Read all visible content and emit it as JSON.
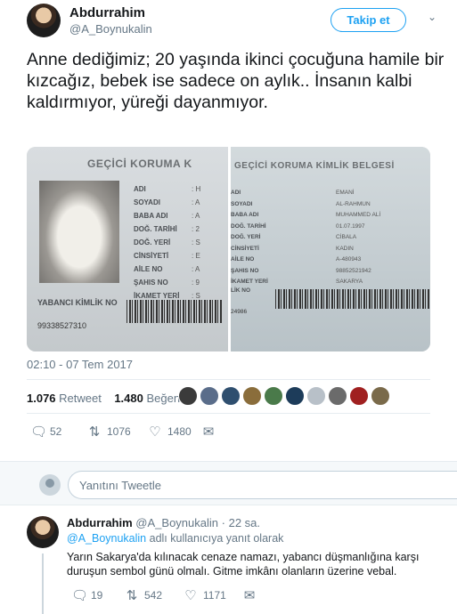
{
  "tweet": {
    "author_name": "Abdurrahim",
    "author_handle": "@A_Boynukalin",
    "follow_label": "Takip et",
    "text": "Anne dediğimiz; 20 yaşında ikinci çocuğuna hamile bir kızcağız, bebek ise sadece on aylık.. İnsanın kalbi kaldırmıyor, yüreği dayanmıyor.",
    "timestamp": "02:10 - 07 Tem 2017",
    "retweets_count": "1.076",
    "retweets_label": "Retweet",
    "likes_count": "1.480",
    "likes_label": "Beğeni",
    "reply_count": "52",
    "retweet_count_action": "1076",
    "like_count_action": "1480",
    "liker_colors": [
      "#3b3b3b",
      "#5a6d8a",
      "#2f4f6f",
      "#8a6d3b",
      "#4a7a4a",
      "#1d3c5a",
      "#b8c0c8",
      "#6b6b6b",
      "#a02020",
      "#7a6a4a"
    ]
  },
  "card_left": {
    "title": "GEÇİCİ KORUMA K",
    "fields": [
      "ADI",
      "SOYADI",
      "BABA ADI",
      "DOĞ. TARİHİ",
      "DOĞ. YERİ",
      "CİNSİYETİ",
      "AİLE NO",
      "ŞAHIS NO",
      "İKAMET YERİ"
    ],
    "values": [
      ": H",
      ": A",
      ": A",
      ": 2",
      ": S",
      ": E",
      ": A",
      ": 9",
      ": S"
    ],
    "yabanci": "YABANCI KİMLİK NO",
    "idno": "99338527310"
  },
  "card_right": {
    "title": "GEÇİCİ KORUMA KİMLİK BELGESİ",
    "fields": [
      "ADI",
      "SOYADI",
      "BABA ADI",
      "DOĞ. TARİHİ",
      "DOĞ. YERİ",
      "CİNSİYETİ",
      "AİLE NO",
      "ŞAHIS NO",
      "İKAMET YERİ"
    ],
    "values": [
      "EMANİ",
      "AL-RAHMUN",
      "MUHAMMED ALİ",
      "01.07.1997",
      "CİBALA",
      "KADIN",
      "A-480943",
      "98852521942",
      "SAKARYA"
    ],
    "yabanci": "LİK NO",
    "idno": "24986"
  },
  "reply_box": {
    "placeholder": "Yanıtını Tweetle"
  },
  "reply": {
    "author_name": "Abdurrahim",
    "author_handle": "@A_Boynukalin",
    "time": "22 sa.",
    "to_handle": "@A_Boynukalin",
    "to_suffix": "adlı kullanıcıya yanıt olarak",
    "text": "Yarın Sakarya'da kılınacak cenaze namazı, yabancı düşmanlığına karşı duruşun sembol günü olmalı. Gitme imkânı olanların üzerine vebal.",
    "reply_count": "19",
    "retweet_count": "542",
    "like_count": "1171"
  }
}
